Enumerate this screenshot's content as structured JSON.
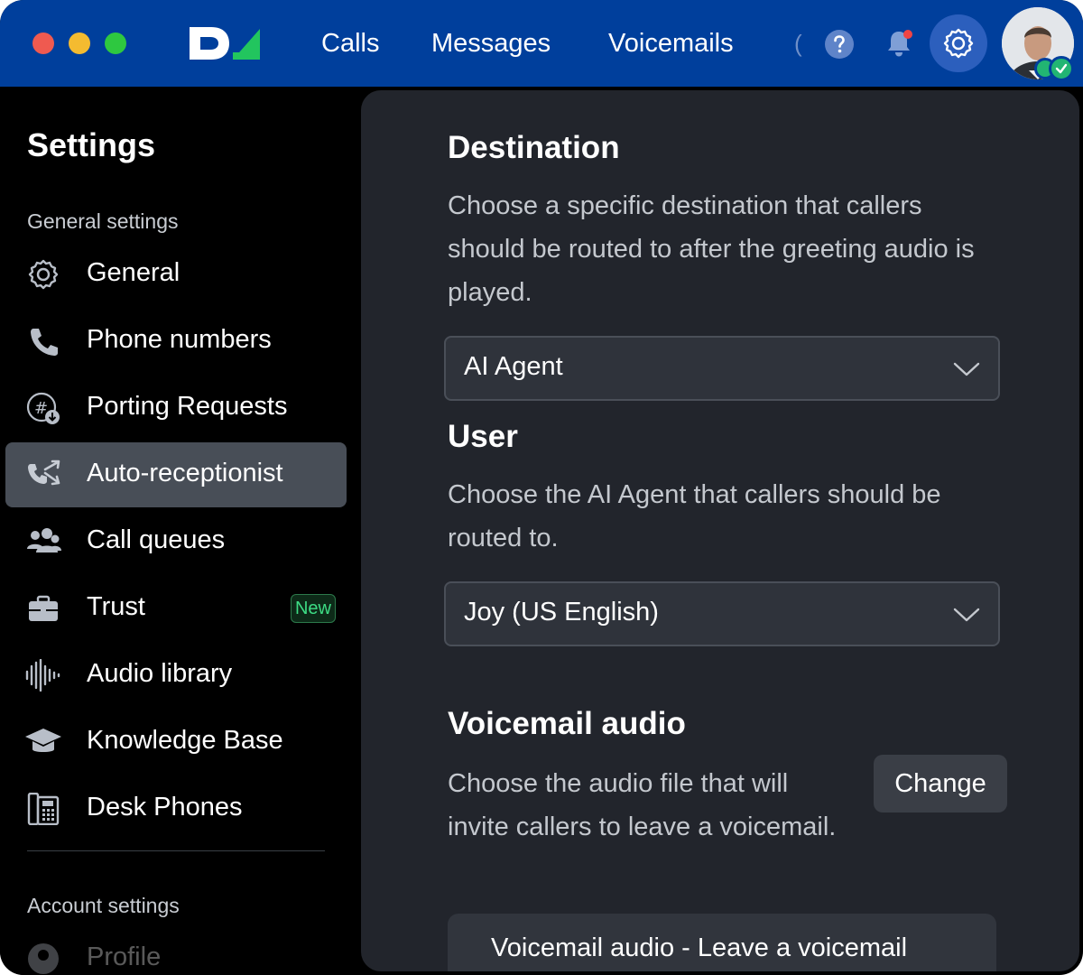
{
  "window": {
    "traffic_lights": [
      "close",
      "minimize",
      "zoom"
    ]
  },
  "topnav": {
    "logo_icon": "dialpad-logo",
    "links": [
      "Calls",
      "Messages",
      "Voicemails"
    ],
    "more_hint": "(",
    "icons": [
      "help-icon",
      "bell-icon",
      "gear-icon"
    ],
    "colors": {
      "bar": "#003f9c",
      "active_button": "#2c5fbd"
    }
  },
  "sidebar": {
    "title": "Settings",
    "general_heading": "General settings",
    "items": [
      {
        "label": "General",
        "icon": "gear-icon"
      },
      {
        "label": "Phone numbers",
        "icon": "phone-icon"
      },
      {
        "label": "Porting Requests",
        "icon": "hash-download-icon"
      },
      {
        "label": "Auto-receptionist",
        "icon": "routing-icon",
        "active": true
      },
      {
        "label": "Call queues",
        "icon": "people-icon"
      },
      {
        "label": "Trust",
        "icon": "briefcase-icon",
        "badge": "New"
      },
      {
        "label": "Audio library",
        "icon": "waveform-icon"
      },
      {
        "label": "Knowledge Base",
        "icon": "graduation-cap-icon"
      },
      {
        "label": "Desk Phones",
        "icon": "desk-phone-icon"
      }
    ],
    "account_heading": "Account settings",
    "account_items": [
      {
        "label": "Profile",
        "icon": "user-icon"
      }
    ]
  },
  "main": {
    "destination": {
      "title": "Destination",
      "description": "Choose a specific destination that callers should be routed to after the greeting audio is played.",
      "selected": "AI Agent"
    },
    "user": {
      "title": "User",
      "description": "Choose the AI Agent that callers should be routed to.",
      "selected": "Joy (US English)"
    },
    "voicemail": {
      "title": "Voicemail audio",
      "description": "Choose the audio file that will invite callers to leave a voicemail.",
      "change_label": "Change",
      "current_audio": "Voicemail audio - Leave a voicemail"
    }
  }
}
